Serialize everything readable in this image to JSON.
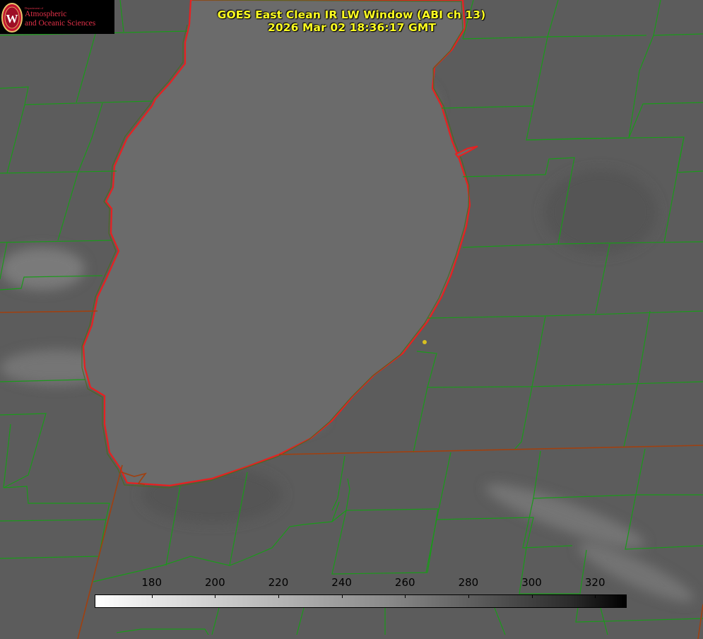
{
  "header": {
    "title_line1": "GOES East Clean IR LW Window (ABI ch 13)",
    "title_line2": "2026 Mar 02 18:36:17 GMT",
    "title_color": "#ffff22"
  },
  "logo": {
    "dept": "Department of",
    "line1": "Atmospheric",
    "line2": "and Oceanic Sciences",
    "text_color": "#e03048"
  },
  "colorbar": {
    "ticks": [
      {
        "label": "180",
        "value": 180
      },
      {
        "label": "200",
        "value": 200
      },
      {
        "label": "220",
        "value": 220
      },
      {
        "label": "240",
        "value": 240
      },
      {
        "label": "260",
        "value": 260
      },
      {
        "label": "280",
        "value": 280
      },
      {
        "label": "300",
        "value": 300
      },
      {
        "label": "320",
        "value": 320
      }
    ],
    "range": [
      162,
      330
    ],
    "colormap": "white-to-black"
  },
  "map": {
    "lake_outline_color": "#e82020",
    "boundary_color": "#1a9a1a",
    "state_line_color": "#a04010",
    "marker_color": "#d8c020"
  }
}
